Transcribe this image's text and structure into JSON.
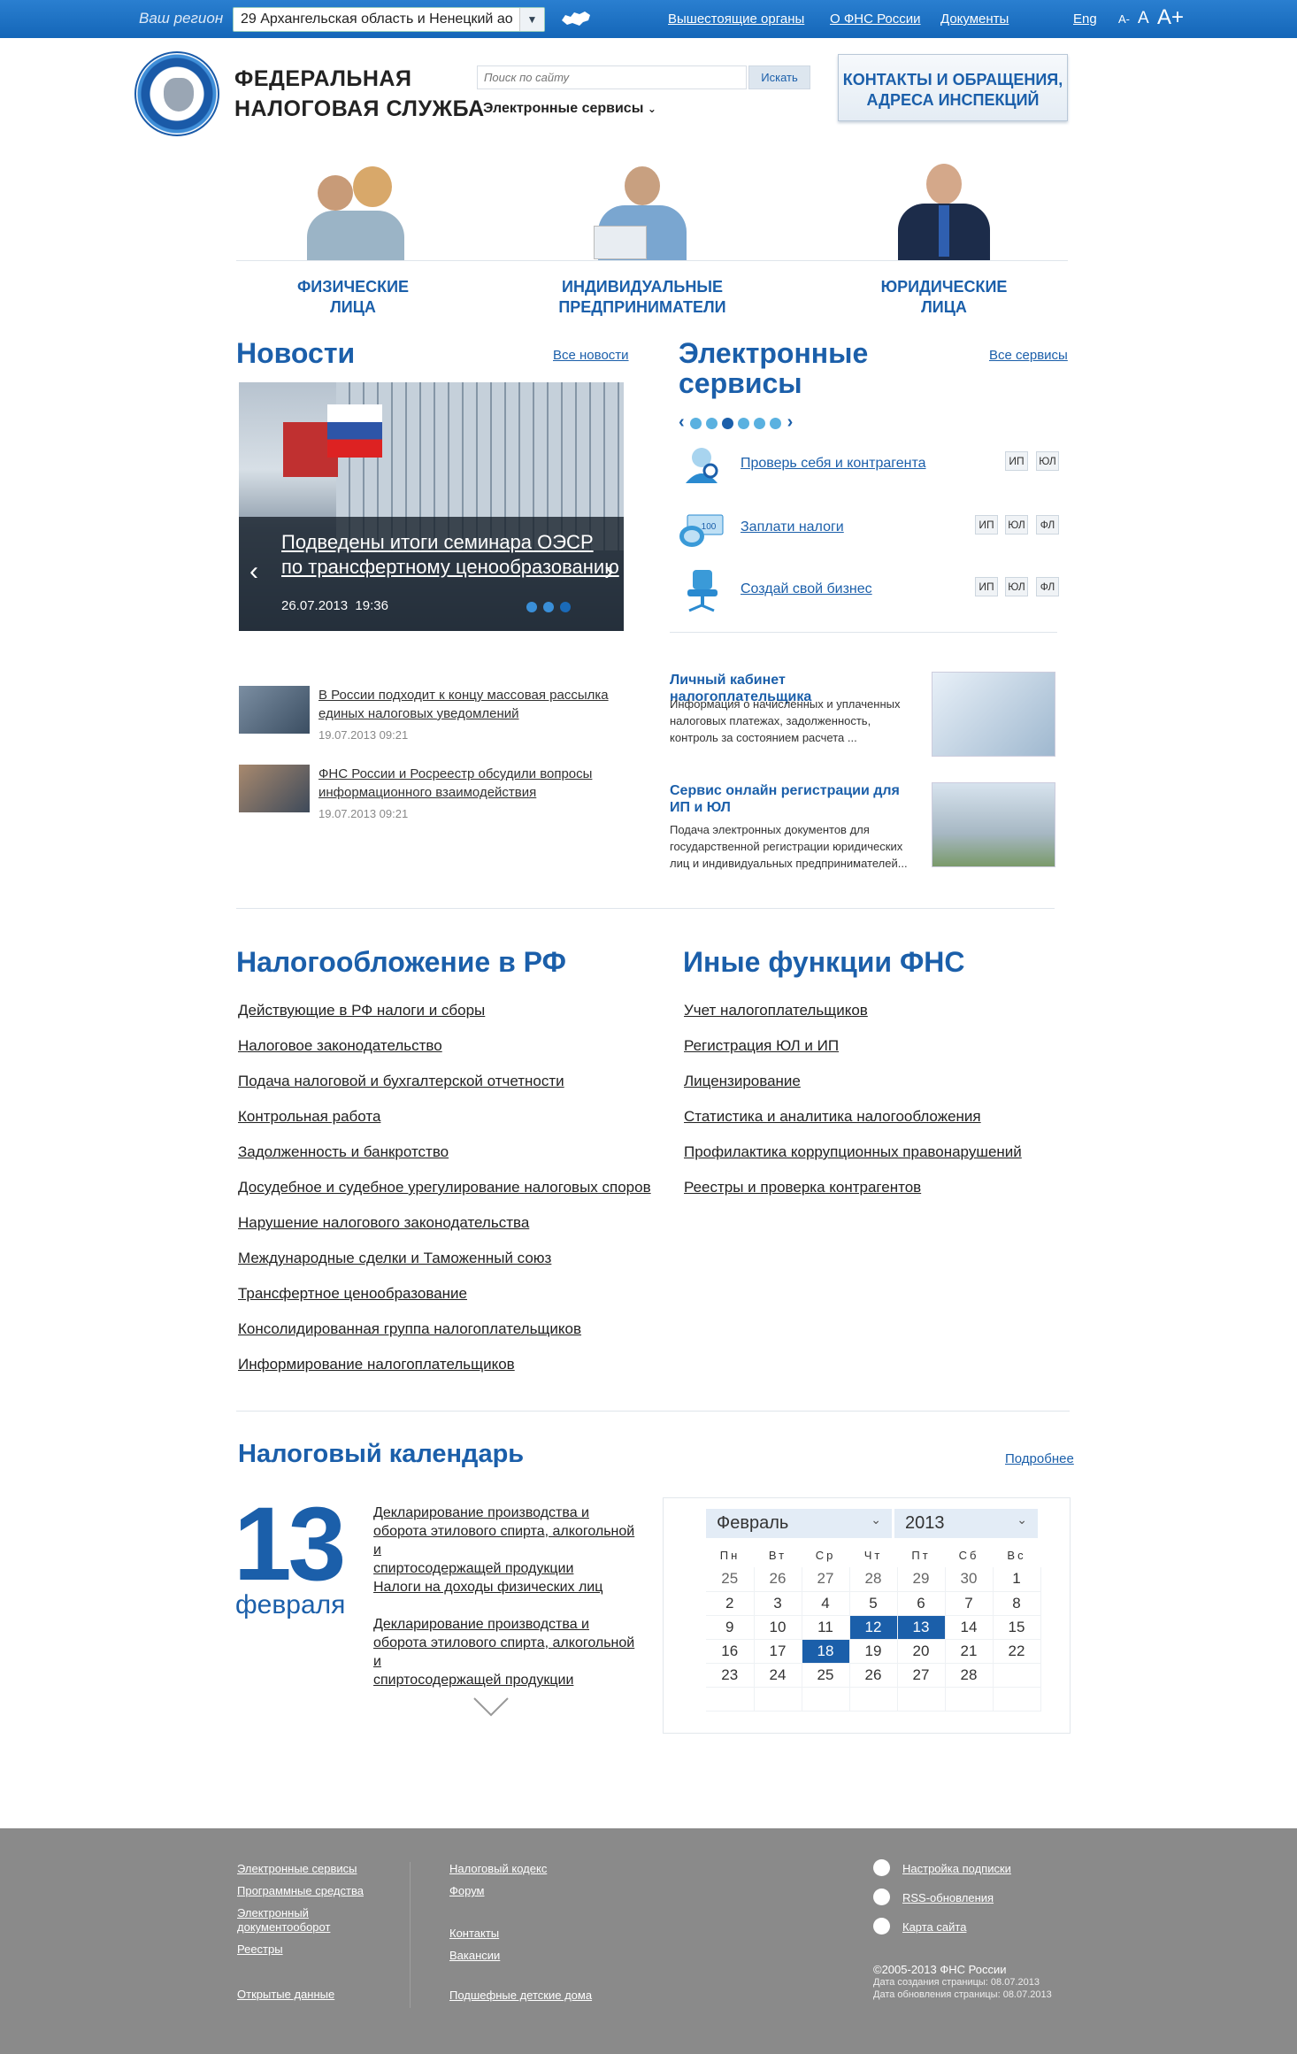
{
  "topbar": {
    "region_label": "Ваш регион",
    "region_value": "29 Архангельская область и Ненецкий ао",
    "nav": [
      "Вышестоящие органы",
      "О ФНС России",
      "Документы"
    ],
    "lang": "Eng",
    "font_small": "A-",
    "font_normal": "A",
    "font_large": "A+"
  },
  "header": {
    "title_line1": "ФЕДЕРАЛЬНАЯ",
    "title_line2": "НАЛОГОВАЯ СЛУЖБА",
    "search_placeholder": "Поиск по сайту",
    "search_button": "Искать",
    "eservices_dropdown": "Электронные сервисы",
    "contacts_line1": "КОНТАКТЫ И ОБРАЩЕНИЯ,",
    "contacts_line2": "АДРЕСА ИНСПЕКЦИЙ"
  },
  "audiences": [
    {
      "line1": "ФИЗИЧЕСКИЕ",
      "line2": "ЛИЦА"
    },
    {
      "line1": "ИНДИВИДУАЛЬНЫЕ",
      "line2": "ПРЕДПРИНИМАТЕЛИ"
    },
    {
      "line1": "ЮРИДИЧЕСКИЕ",
      "line2": "ЛИЦА"
    }
  ],
  "news": {
    "title": "Новости",
    "all_link": "Все новости",
    "slide_line1": "Подведены итоги семинара ОЭСР",
    "slide_line2": "по трансфертному ценообразованию",
    "slide_date": "26.07.2013",
    "slide_time": "19:36",
    "items": [
      {
        "line1": "В России подходит к концу массовая рассылка",
        "line2": "единых налоговых уведомлений",
        "date": "19.07.2013  09:21"
      },
      {
        "line1": "ФНС России и Росреестр обсудили вопросы",
        "line2": "информационного взаимодействия",
        "date": "19.07.2013  09:21"
      }
    ]
  },
  "eservices": {
    "title_line1": "Электронные",
    "title_line2": "сервисы",
    "all_link": "Все сервисы",
    "prev": "‹",
    "next": "›",
    "services": [
      {
        "label": "Проверь себя и контрагента",
        "tags": [
          "ИП",
          "ЮЛ"
        ],
        "icon": "magnifier-person-icon"
      },
      {
        "label": "Заплати налоги",
        "tags": [
          "ИП",
          "ЮЛ",
          "ФЛ"
        ],
        "icon": "coins-icon"
      },
      {
        "label": "Создай свой бизнес",
        "tags": [
          "ИП",
          "ЮЛ",
          "ФЛ"
        ],
        "icon": "chair-icon"
      }
    ],
    "promos": [
      {
        "title": "Личный кабинет налогоплательщика",
        "desc1": "Информация о начисленных и уплаченных",
        "desc2": "налоговых платежах, задолженность,",
        "desc3": "контроль за состоянием расчета ..."
      },
      {
        "title": "Сервис онлайн регистрации для",
        "title2": "ИП и ЮЛ",
        "desc1": "Подача электронных документов для",
        "desc2": "государственной регистрации юридических",
        "desc3": "лиц и индивидуальных предпринимателей..."
      }
    ]
  },
  "taxation": {
    "title": "Налогообложение в РФ",
    "items": [
      "Действующие в РФ налоги и сборы",
      "Налоговое законодательство",
      "Подача налоговой  и бухгалтерской отчетности",
      "Контрольная работа",
      "Задолженность  и банкротство",
      "Досудебное и судебное урегулирование налоговых споров",
      "Нарушение налогового законодательства",
      "Международные сделки и Таможенный союз",
      "Трансфертное ценообразование",
      "Консолидированная группа налогоплательщиков",
      "Информирование налогоплательщиков"
    ]
  },
  "other": {
    "title": "Иные функции ФНС",
    "items": [
      "Учет налогоплательщиков",
      "Регистрация ЮЛ и ИП",
      "Лицензирование",
      "Статистика и аналитика налогообложения",
      "Профилактика коррупционных правонарушений",
      "Реестры и проверка контрагентов"
    ]
  },
  "calendar": {
    "title": "Налоговый календарь",
    "more_link": "Подробнее",
    "day": "13",
    "month": "февраля",
    "events": [
      {
        "l1": "Декларирование производства и",
        "l2": "оборота этилового спирта, алкогольной и",
        "l3": "спиртосодержащей продукции"
      },
      {
        "l1": "Налоги на доходы физических лиц",
        "l2": "",
        "l3": ""
      },
      {
        "l1": "Декларирование производства и",
        "l2": "оборота этилового спирта, алкогольной и",
        "l3": "спиртосодержащей продукции"
      }
    ],
    "month_select": "Февраль",
    "year_select": "2013",
    "weekdays": [
      "Пн",
      "Вт",
      "Ср",
      "Чт",
      "Пт",
      "Сб",
      "Вс"
    ],
    "weeks": [
      [
        "25",
        "26",
        "27",
        "28",
        "29",
        "30",
        "1"
      ],
      [
        "2",
        "3",
        "4",
        "5",
        "6",
        "7",
        "8"
      ],
      [
        "9",
        "10",
        "11",
        "12",
        "13",
        "14",
        "15"
      ],
      [
        "16",
        "17",
        "18",
        "19",
        "20",
        "21",
        "22"
      ],
      [
        "23",
        "24",
        "25",
        "26",
        "27",
        "28",
        ""
      ]
    ],
    "highlight": [
      "12",
      "13",
      "18"
    ]
  },
  "footer": {
    "col1": [
      "Электронные сервисы",
      "Программные средства",
      "Электронный",
      "документооборот",
      "Реестры",
      "Открытые данные"
    ],
    "col2": [
      "Налоговый кодекс",
      "Форум",
      "Контакты",
      "Вакансии",
      "Подшефные детские дома"
    ],
    "col3": [
      "Настройка подписки",
      "RSS-обновления",
      "Карта сайта"
    ],
    "copyright": "©2005-2013 ФНС России",
    "created": "Дата создания страницы: 08.07.2013",
    "updated": "Дата обновления страницы: 08.07.2013"
  }
}
